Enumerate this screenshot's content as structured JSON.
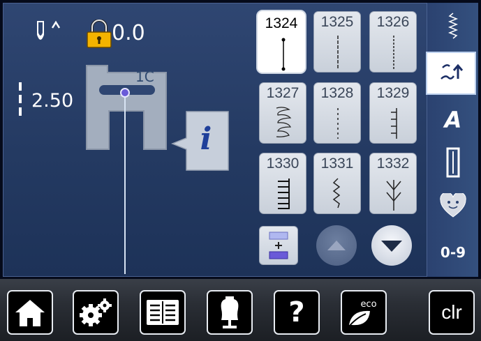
{
  "status": {
    "needle_position_icon": "needle-up-icon",
    "lock_icon": "padlock-icon",
    "lock_value": "0.0",
    "stitch_length_icon": "stitch-length-icon",
    "stitch_length_value": "2.50"
  },
  "presser_foot": {
    "label": "1C"
  },
  "info_button": {
    "icon": "info-icon",
    "glyph": "i"
  },
  "stitches": [
    {
      "number": "1324",
      "selected": true,
      "icon": "straight-stitch-icon"
    },
    {
      "number": "1325",
      "selected": false,
      "icon": "long-straight-stitch-icon"
    },
    {
      "number": "1326",
      "selected": false,
      "icon": "dashed-stitch-icon"
    },
    {
      "number": "1327",
      "selected": false,
      "icon": "stretch-stitch-icon"
    },
    {
      "number": "1328",
      "selected": false,
      "icon": "short-dashed-stitch-icon"
    },
    {
      "number": "1329",
      "selected": false,
      "icon": "blind-stitch-icon"
    },
    {
      "number": "1330",
      "selected": false,
      "icon": "overlock-stitch-icon"
    },
    {
      "number": "1331",
      "selected": false,
      "icon": "zigzag-stitch-icon"
    },
    {
      "number": "1332",
      "selected": false,
      "icon": "feather-stitch-icon"
    }
  ],
  "grid_controls": {
    "split_icon": "split-view-icon",
    "scroll_up_icon": "triangle-up-icon",
    "scroll_down_icon": "triangle-down-icon"
  },
  "sidebar": {
    "items": [
      {
        "icon": "practical-stitches-icon",
        "active": false
      },
      {
        "icon": "utility-stitch-back-icon",
        "active": true
      },
      {
        "icon": "alphabet-icon",
        "label": "A",
        "active": false
      },
      {
        "icon": "buttonhole-icon",
        "active": false
      },
      {
        "icon": "heart-icon",
        "active": false
      },
      {
        "icon": "number-icon",
        "label": "0-9",
        "active": false
      }
    ]
  },
  "toolbar": {
    "home_icon": "home-icon",
    "setup_icon": "gears-icon",
    "tutorial_icon": "book-icon",
    "consultant_icon": "dress-form-icon",
    "help_icon": "question-icon",
    "help_glyph": "?",
    "eco_icon": "eco-leaf-icon",
    "eco_label": "eco",
    "clear_label": "clr"
  },
  "colors": {
    "display_bg": "#2b4270",
    "selected_border": "#ffffff",
    "needle_dot": "#6a5ad8",
    "lock_yellow": "#f4b400"
  }
}
